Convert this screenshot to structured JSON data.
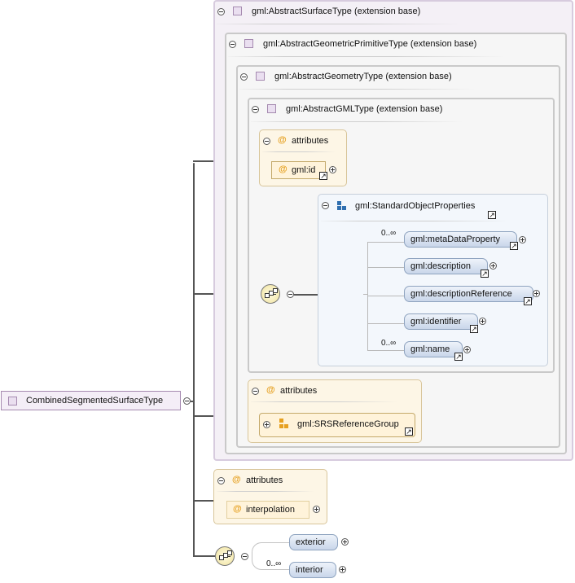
{
  "root": {
    "label": "CombinedSegmentedSurfaceType"
  },
  "ext1": {
    "label": "gml:AbstractSurfaceType (extension base)"
  },
  "ext2": {
    "label": "gml:AbstractGeometricPrimitiveType (extension base)"
  },
  "ext3": {
    "label": "gml:AbstractGeometryType (extension base)"
  },
  "ext4": {
    "label": "gml:AbstractGMLType (extension base)"
  },
  "gmlAttrs": {
    "title": "attributes",
    "item": "gml:id"
  },
  "group": {
    "label": "gml:StandardObjectProperties",
    "items": [
      {
        "label": "gml:metaDataProperty",
        "mult": "0..∞"
      },
      {
        "label": "gml:description",
        "mult": ""
      },
      {
        "label": "gml:descriptionReference",
        "mult": ""
      },
      {
        "label": "gml:identifier",
        "mult": ""
      },
      {
        "label": "gml:name",
        "mult": "0..∞"
      }
    ]
  },
  "geomAttrs": {
    "title": "attributes",
    "item": "gml:SRSReferenceGroup"
  },
  "ownAttrs": {
    "title": "attributes",
    "item": "interpolation"
  },
  "seqItems": [
    {
      "label": "exterior",
      "mult": ""
    },
    {
      "label": "interior",
      "mult": "0..∞"
    }
  ],
  "symbols": {
    "attribute": "@"
  }
}
